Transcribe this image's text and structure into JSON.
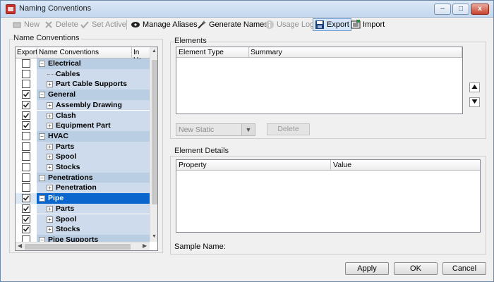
{
  "window": {
    "title": "Naming Conventions",
    "min_glyph": "–",
    "max_glyph": "□",
    "close_glyph": "x"
  },
  "toolbar": {
    "new_label": "New",
    "delete_label": "Delete",
    "set_active_label": "Set Active",
    "manage_aliases_label": "Manage Aliases",
    "generate_names_label": "Generate Names",
    "usage_log_label": "Usage Log",
    "export_label": "Export",
    "import_label": "Import",
    "icons": {
      "new": "new-icon",
      "delete": "delete-icon",
      "set_active": "check-icon",
      "manage_aliases": "alias-icon",
      "generate_names": "wand-icon",
      "usage_log": "info-icon",
      "export": "save-icon",
      "import": "import-icon"
    }
  },
  "left_panel": {
    "group_label": "Name Conventions",
    "columns": [
      "Export",
      "Name Conventions",
      "In Us"
    ],
    "rows": [
      {
        "label": "Electrical",
        "checked": false,
        "level": 0,
        "expander": "−",
        "group": true
      },
      {
        "label": "Cables",
        "checked": false,
        "level": 1,
        "expander": "",
        "group": false
      },
      {
        "label": "Part Cable Supports",
        "checked": false,
        "level": 1,
        "expander": "+",
        "group": false
      },
      {
        "label": "General",
        "checked": true,
        "level": 0,
        "expander": "−",
        "group": true
      },
      {
        "label": "Assembly Drawing",
        "checked": true,
        "level": 1,
        "expander": "+",
        "group": false
      },
      {
        "label": "Clash",
        "checked": true,
        "level": 1,
        "expander": "+",
        "group": false
      },
      {
        "label": "Equipment Part",
        "checked": true,
        "level": 1,
        "expander": "+",
        "group": false
      },
      {
        "label": "HVAC",
        "checked": false,
        "level": 0,
        "expander": "−",
        "group": true
      },
      {
        "label": "Parts",
        "checked": false,
        "level": 1,
        "expander": "+",
        "group": false
      },
      {
        "label": "Spool",
        "checked": false,
        "level": 1,
        "expander": "+",
        "group": false
      },
      {
        "label": "Stocks",
        "checked": false,
        "level": 1,
        "expander": "+",
        "group": false
      },
      {
        "label": "Penetrations",
        "checked": false,
        "level": 0,
        "expander": "−",
        "group": true
      },
      {
        "label": "Penetration",
        "checked": false,
        "level": 1,
        "expander": "+",
        "group": false
      },
      {
        "label": "Pipe",
        "checked": true,
        "level": 0,
        "expander": "−",
        "group": true,
        "selected": true
      },
      {
        "label": "Parts",
        "checked": true,
        "level": 1,
        "expander": "+",
        "group": false
      },
      {
        "label": "Spool",
        "checked": true,
        "level": 1,
        "expander": "+",
        "group": false
      },
      {
        "label": "Stocks",
        "checked": true,
        "level": 1,
        "expander": "+",
        "group": false
      },
      {
        "label": "Pipe Supports",
        "checked": false,
        "level": 0,
        "expander": "−",
        "group": true
      }
    ]
  },
  "elements": {
    "group_label": "Elements",
    "columns": [
      "Element Type",
      "Summary"
    ],
    "new_static_value": "New Static",
    "delete_label": "Delete"
  },
  "element_details": {
    "group_label": "Element Details",
    "columns": [
      "Property",
      "Value"
    ],
    "sample_name_label": "Sample Name:"
  },
  "footer": {
    "apply_label": "Apply",
    "ok_label": "OK",
    "cancel_label": "Cancel"
  },
  "colors": {
    "selection": "#0a66cc",
    "group_row": "#b9cde3",
    "child_row": "#cddbec"
  }
}
